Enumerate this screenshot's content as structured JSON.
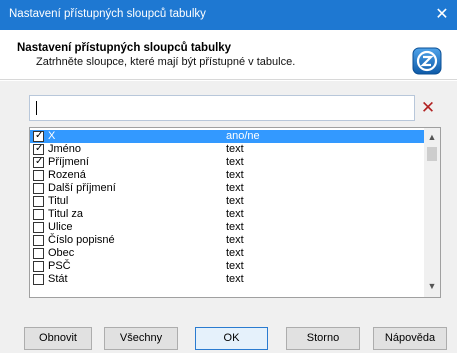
{
  "window": {
    "title": "Nastavení přístupných sloupců tabulky"
  },
  "header": {
    "title": "Nastavení přístupných sloupců tabulky",
    "subtitle": "Zatrhněte sloupce, které mají být přístupné v tabulce."
  },
  "search": {
    "value": ""
  },
  "columns": [
    {
      "name": "X",
      "type": "ano/ne",
      "checked": true,
      "selected": true
    },
    {
      "name": "Jméno",
      "type": "text",
      "checked": true
    },
    {
      "name": "Příjmení",
      "type": "text",
      "checked": true
    },
    {
      "name": "Rozená",
      "type": "text",
      "checked": false
    },
    {
      "name": "Další příjmení",
      "type": "text",
      "checked": false
    },
    {
      "name": "Titul",
      "type": "text",
      "checked": false
    },
    {
      "name": "Titul za",
      "type": "text",
      "checked": false
    },
    {
      "name": "Ulice",
      "type": "text",
      "checked": false
    },
    {
      "name": "Číslo popisné",
      "type": "text",
      "checked": false
    },
    {
      "name": "Obec",
      "type": "text",
      "checked": false
    },
    {
      "name": "PSČ",
      "type": "text",
      "checked": false
    },
    {
      "name": "Stát",
      "type": "text",
      "checked": false
    }
  ],
  "buttons": {
    "refresh": "Obnovit",
    "all": "Všechny",
    "ok": "OK",
    "cancel": "Storno",
    "help": "Nápověda"
  },
  "colors": {
    "accent": "#1e78d2",
    "selection": "#3399ff",
    "clear": "#b22222"
  }
}
